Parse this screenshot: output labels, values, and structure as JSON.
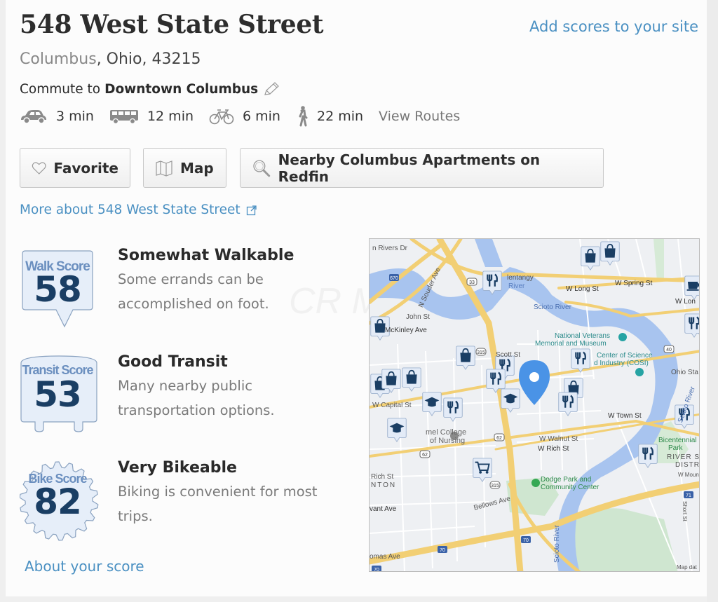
{
  "header": {
    "title": "548 West State Street",
    "add_scores_link": "Add scores to your site",
    "city": "Columbus",
    "state_zip": ", Ohio, 43215",
    "commute_prefix": "Commute to",
    "commute_destination": "Downtown Columbus"
  },
  "commute_modes": [
    {
      "mode": "drive",
      "icon": "car-icon",
      "time": "3 min"
    },
    {
      "mode": "transit",
      "icon": "bus-icon",
      "time": "12 min"
    },
    {
      "mode": "bike",
      "icon": "bicycle-icon",
      "time": "6 min"
    },
    {
      "mode": "walk",
      "icon": "walking-person-icon",
      "time": "22 min"
    }
  ],
  "view_routes": "View Routes",
  "buttons": {
    "favorite": "Favorite",
    "map": "Map",
    "nearby": "Nearby Columbus Apartments on Redfin"
  },
  "more_link": "More about 548 West State Street",
  "scores": [
    {
      "type": "walk",
      "badge_label": "Walk Score",
      "value": "58",
      "title": "Somewhat Walkable",
      "description": "Some errands can be accomplished on foot."
    },
    {
      "type": "transit",
      "badge_label": "Transit Score",
      "value": "53",
      "title": "Good Transit",
      "description": "Many nearby public transportation options."
    },
    {
      "type": "bike",
      "badge_label": "Bike Score",
      "value": "82",
      "title": "Very Bikeable",
      "description": "Biking is convenient for most trips."
    }
  ],
  "about_link": "About your score",
  "watermark": "CR MLS",
  "map": {
    "attribution": "Map dat",
    "labels": {
      "rivers_dr": "n Rivers Dr",
      "olentangy": "lentangy",
      "olentangy_river": "River",
      "spring": "W Spring St",
      "long": "W Long St",
      "long2": "W Lon",
      "scioto": "Scioto River",
      "souder": "N Souder Ave",
      "john": "John St",
      "mckinley": "McKinley Ave",
      "veterans1": "National Veterans",
      "veterans2": "Memorial and Museum",
      "cosi1": "Center of Science",
      "cosi2": "d Industry (COSI)",
      "ohio": "Ohio Sta",
      "capital": "W Capital St",
      "college1": "mel College",
      "college2": "of Nursing",
      "town": "W Town St",
      "walnut": "W Walnut St",
      "rich": "W Rich St",
      "rich2": "Rich St",
      "bicentennial1": "Bicentennial",
      "bicentennial2": "Park",
      "river_dist1": "RIVER S",
      "river_dist2": "DISTR",
      "nton": "NTON",
      "dodge1": "Dodge Park and",
      "dodge2": "Community Center",
      "bellows": "Bellows Ave",
      "vant": "vant Ave",
      "thomas": "omas Ave",
      "scioto2": "Scioto River",
      "scioto3": "Scioto River",
      "short": "Short St",
      "scott": "Scott St",
      "mound": "W Moun"
    },
    "shields": [
      "670",
      "33",
      "315",
      "62",
      "70",
      "71",
      "40"
    ]
  }
}
